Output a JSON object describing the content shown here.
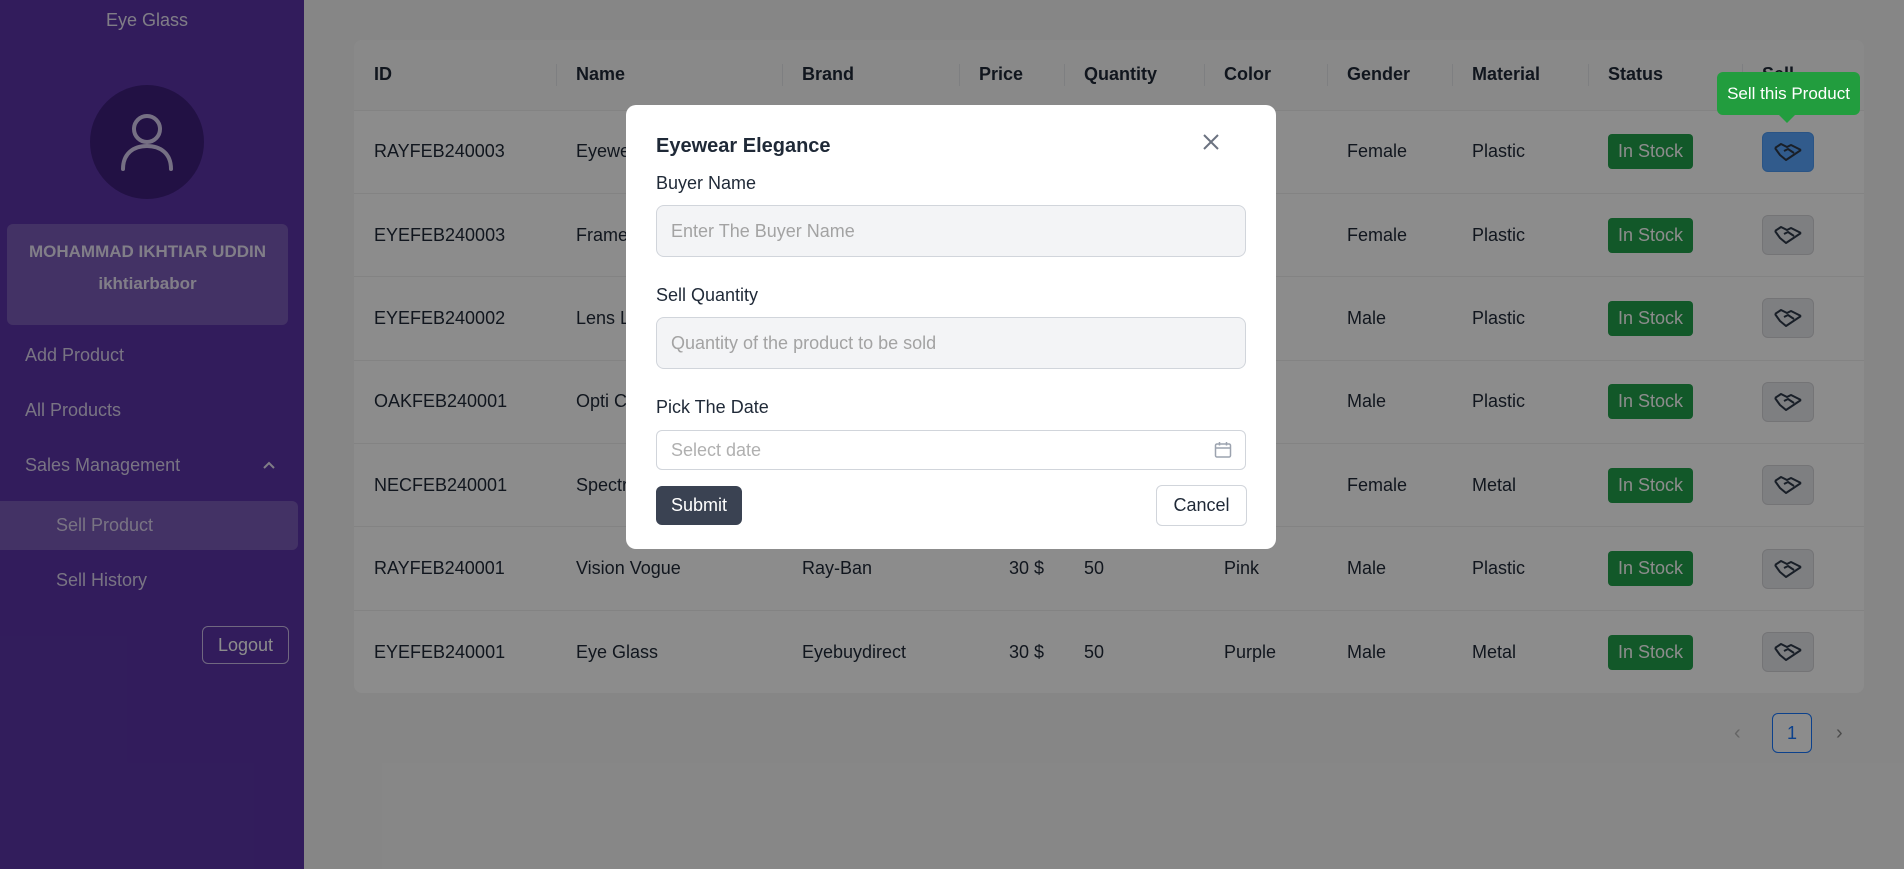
{
  "sidebar": {
    "brand": "Eye Glass",
    "user": {
      "name": "MOHAMMAD IKHTIAR UDDIN",
      "username": "ikhtiarbabor"
    },
    "nav": {
      "add_product": "Add Product",
      "all_products": "All Products",
      "sales_management": "Sales Management",
      "sell_product": "Sell Product",
      "sell_history": "Sell History"
    },
    "logout": "Logout"
  },
  "table": {
    "headers": [
      "ID",
      "Name",
      "Brand",
      "Price",
      "Quantity",
      "Color",
      "Gender",
      "Material",
      "Status",
      "Sell"
    ],
    "rows": [
      {
        "id": "RAYFEB240003",
        "name": "Eyewear Elegance",
        "brand": "",
        "price": "",
        "quantity": "",
        "color": "",
        "gender": "Female",
        "material": "Plastic",
        "status": "In Stock"
      },
      {
        "id": "EYEFEB240003",
        "name": "Frame",
        "brand": "",
        "price": "",
        "quantity": "",
        "color": "",
        "gender": "Female",
        "material": "Plastic",
        "status": "In Stock"
      },
      {
        "id": "EYEFEB240002",
        "name": "Lens L",
        "brand": "",
        "price": "",
        "quantity": "",
        "color": "n",
        "gender": "Male",
        "material": "Plastic",
        "status": "In Stock"
      },
      {
        "id": "OAKFEB240001",
        "name": "Opti C",
        "brand": "",
        "price": "",
        "quantity": "",
        "color": "",
        "gender": "Male",
        "material": "Plastic",
        "status": "In Stock"
      },
      {
        "id": "NECFEB240001",
        "name": "Spectr",
        "brand": "",
        "price": "",
        "quantity": "",
        "color": "",
        "gender": "Female",
        "material": "Metal",
        "status": "In Stock"
      },
      {
        "id": "RAYFEB240001",
        "name": "Vision Vogue",
        "brand": "Ray-Ban",
        "price": "30 $",
        "quantity": "50",
        "color": "Pink",
        "gender": "Male",
        "material": "Plastic",
        "status": "In Stock"
      },
      {
        "id": "EYEFEB240001",
        "name": "Eye Glass",
        "brand": "Eyebuydirect",
        "price": "30 $",
        "quantity": "50",
        "color": "Purple",
        "gender": "Male",
        "material": "Metal",
        "status": "In Stock"
      }
    ]
  },
  "pagination": {
    "prev": "‹",
    "current": "1",
    "next": "›"
  },
  "tooltip": "Sell this Product",
  "modal": {
    "title": "Eyewear Elegance",
    "buyer_label": "Buyer Name",
    "buyer_placeholder": "Enter The Buyer Name",
    "quantity_label": "Sell Quantity",
    "quantity_placeholder": "Quantity of the product to be sold",
    "date_label": "Pick The Date",
    "date_placeholder": "Select date",
    "submit": "Submit",
    "cancel": "Cancel"
  },
  "colors": {
    "sidebar": "#5b34a8",
    "in_stock": "#22a04b",
    "tooltip": "#229d3e",
    "submit": "#3a4252",
    "primary": "#1677ff"
  }
}
